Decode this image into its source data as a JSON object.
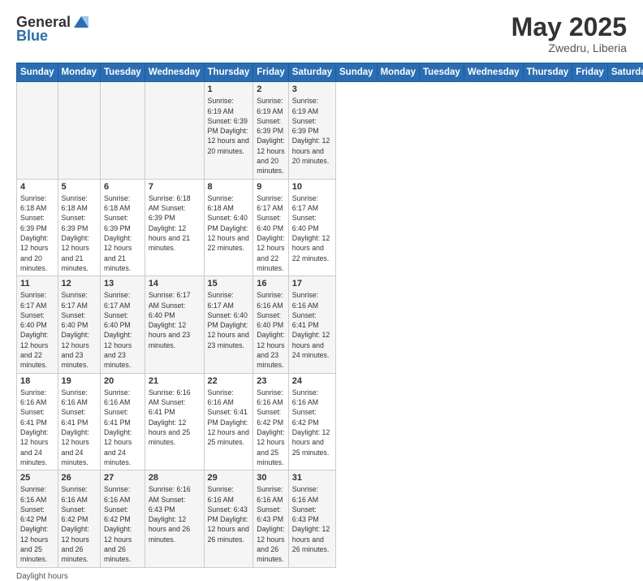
{
  "header": {
    "logo_general": "General",
    "logo_blue": "Blue",
    "month": "May 2025",
    "location": "Zwedru, Liberia"
  },
  "days_of_week": [
    "Sunday",
    "Monday",
    "Tuesday",
    "Wednesday",
    "Thursday",
    "Friday",
    "Saturday"
  ],
  "weeks": [
    [
      {
        "day": "",
        "info": ""
      },
      {
        "day": "",
        "info": ""
      },
      {
        "day": "",
        "info": ""
      },
      {
        "day": "",
        "info": ""
      },
      {
        "day": "1",
        "info": "Sunrise: 6:19 AM\nSunset: 6:39 PM\nDaylight: 12 hours\nand 20 minutes."
      },
      {
        "day": "2",
        "info": "Sunrise: 6:19 AM\nSunset: 6:39 PM\nDaylight: 12 hours\nand 20 minutes."
      },
      {
        "day": "3",
        "info": "Sunrise: 6:19 AM\nSunset: 6:39 PM\nDaylight: 12 hours\nand 20 minutes."
      }
    ],
    [
      {
        "day": "4",
        "info": "Sunrise: 6:18 AM\nSunset: 6:39 PM\nDaylight: 12 hours\nand 20 minutes."
      },
      {
        "day": "5",
        "info": "Sunrise: 6:18 AM\nSunset: 6:39 PM\nDaylight: 12 hours\nand 21 minutes."
      },
      {
        "day": "6",
        "info": "Sunrise: 6:18 AM\nSunset: 6:39 PM\nDaylight: 12 hours\nand 21 minutes."
      },
      {
        "day": "7",
        "info": "Sunrise: 6:18 AM\nSunset: 6:39 PM\nDaylight: 12 hours\nand 21 minutes."
      },
      {
        "day": "8",
        "info": "Sunrise: 6:18 AM\nSunset: 6:40 PM\nDaylight: 12 hours\nand 22 minutes."
      },
      {
        "day": "9",
        "info": "Sunrise: 6:17 AM\nSunset: 6:40 PM\nDaylight: 12 hours\nand 22 minutes."
      },
      {
        "day": "10",
        "info": "Sunrise: 6:17 AM\nSunset: 6:40 PM\nDaylight: 12 hours\nand 22 minutes."
      }
    ],
    [
      {
        "day": "11",
        "info": "Sunrise: 6:17 AM\nSunset: 6:40 PM\nDaylight: 12 hours\nand 22 minutes."
      },
      {
        "day": "12",
        "info": "Sunrise: 6:17 AM\nSunset: 6:40 PM\nDaylight: 12 hours\nand 23 minutes."
      },
      {
        "day": "13",
        "info": "Sunrise: 6:17 AM\nSunset: 6:40 PM\nDaylight: 12 hours\nand 23 minutes."
      },
      {
        "day": "14",
        "info": "Sunrise: 6:17 AM\nSunset: 6:40 PM\nDaylight: 12 hours\nand 23 minutes."
      },
      {
        "day": "15",
        "info": "Sunrise: 6:17 AM\nSunset: 6:40 PM\nDaylight: 12 hours\nand 23 minutes."
      },
      {
        "day": "16",
        "info": "Sunrise: 6:16 AM\nSunset: 6:40 PM\nDaylight: 12 hours\nand 23 minutes."
      },
      {
        "day": "17",
        "info": "Sunrise: 6:16 AM\nSunset: 6:41 PM\nDaylight: 12 hours\nand 24 minutes."
      }
    ],
    [
      {
        "day": "18",
        "info": "Sunrise: 6:16 AM\nSunset: 6:41 PM\nDaylight: 12 hours\nand 24 minutes."
      },
      {
        "day": "19",
        "info": "Sunrise: 6:16 AM\nSunset: 6:41 PM\nDaylight: 12 hours\nand 24 minutes."
      },
      {
        "day": "20",
        "info": "Sunrise: 6:16 AM\nSunset: 6:41 PM\nDaylight: 12 hours\nand 24 minutes."
      },
      {
        "day": "21",
        "info": "Sunrise: 6:16 AM\nSunset: 6:41 PM\nDaylight: 12 hours\nand 25 minutes."
      },
      {
        "day": "22",
        "info": "Sunrise: 6:16 AM\nSunset: 6:41 PM\nDaylight: 12 hours\nand 25 minutes."
      },
      {
        "day": "23",
        "info": "Sunrise: 6:16 AM\nSunset: 6:42 PM\nDaylight: 12 hours\nand 25 minutes."
      },
      {
        "day": "24",
        "info": "Sunrise: 6:16 AM\nSunset: 6:42 PM\nDaylight: 12 hours\nand 25 minutes."
      }
    ],
    [
      {
        "day": "25",
        "info": "Sunrise: 6:16 AM\nSunset: 6:42 PM\nDaylight: 12 hours\nand 25 minutes."
      },
      {
        "day": "26",
        "info": "Sunrise: 6:16 AM\nSunset: 6:42 PM\nDaylight: 12 hours\nand 26 minutes."
      },
      {
        "day": "27",
        "info": "Sunrise: 6:16 AM\nSunset: 6:42 PM\nDaylight: 12 hours\nand 26 minutes."
      },
      {
        "day": "28",
        "info": "Sunrise: 6:16 AM\nSunset: 6:43 PM\nDaylight: 12 hours\nand 26 minutes."
      },
      {
        "day": "29",
        "info": "Sunrise: 6:16 AM\nSunset: 6:43 PM\nDaylight: 12 hours\nand 26 minutes."
      },
      {
        "day": "30",
        "info": "Sunrise: 6:16 AM\nSunset: 6:43 PM\nDaylight: 12 hours\nand 26 minutes."
      },
      {
        "day": "31",
        "info": "Sunrise: 6:16 AM\nSunset: 6:43 PM\nDaylight: 12 hours\nand 26 minutes."
      }
    ]
  ],
  "footer": {
    "note": "Daylight hours"
  }
}
